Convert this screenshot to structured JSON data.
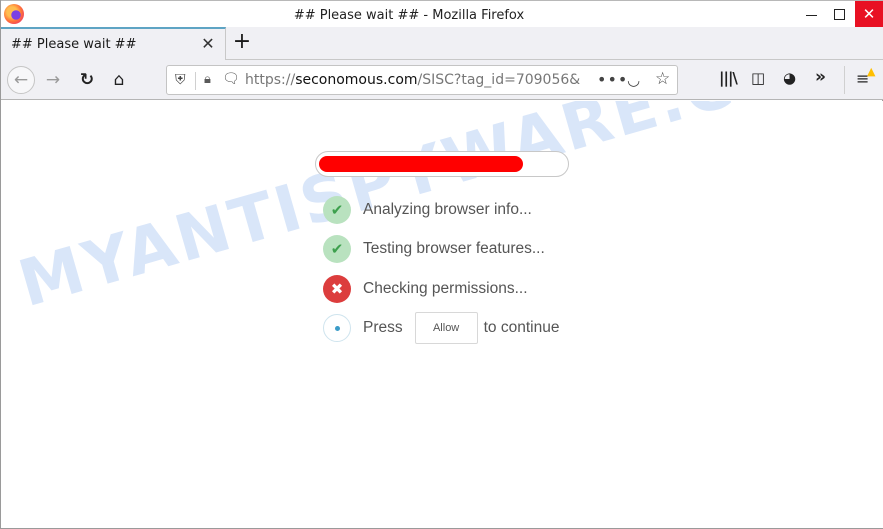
{
  "window": {
    "title": "## Please wait ## - Mozilla Firefox",
    "controls": {
      "minimize": "minimize",
      "maximize": "maximize",
      "close": "✕"
    }
  },
  "tabs": [
    {
      "label": "## Please wait ##",
      "active": true,
      "close_glyph": "✕"
    }
  ],
  "new_tab_glyph": "+",
  "navbar": {
    "back_glyph": "←",
    "forward_glyph": "→",
    "reload_glyph": "↻",
    "home_glyph": "⌂",
    "url": {
      "scheme": "https://",
      "host": "seconomous.com",
      "path": "/SISC?tag_id=709056&"
    },
    "more_glyph": "•••",
    "pocket_glyph": "◡",
    "star_glyph": "☆",
    "toolbar": {
      "library_glyph": "|||\\",
      "sidebar_glyph": "◫",
      "tracker_glyph": "◕",
      "overflow_glyph": "»",
      "menu_glyph": "≡",
      "warning_glyph": "▲"
    }
  },
  "page": {
    "watermark": "MYANTISPYWARE.COM",
    "progress": {
      "percent": 83,
      "color": "#ff0000"
    },
    "steps": [
      {
        "status": "done",
        "icon": "✔",
        "label": "Analyzing browser info..."
      },
      {
        "status": "done",
        "icon": "✔",
        "label": "Testing browser features..."
      },
      {
        "status": "failed",
        "icon": "✖",
        "label": "Checking permissions..."
      },
      {
        "status": "pending",
        "label": "Press",
        "button": "Allow",
        "after": "to continue"
      }
    ]
  }
}
